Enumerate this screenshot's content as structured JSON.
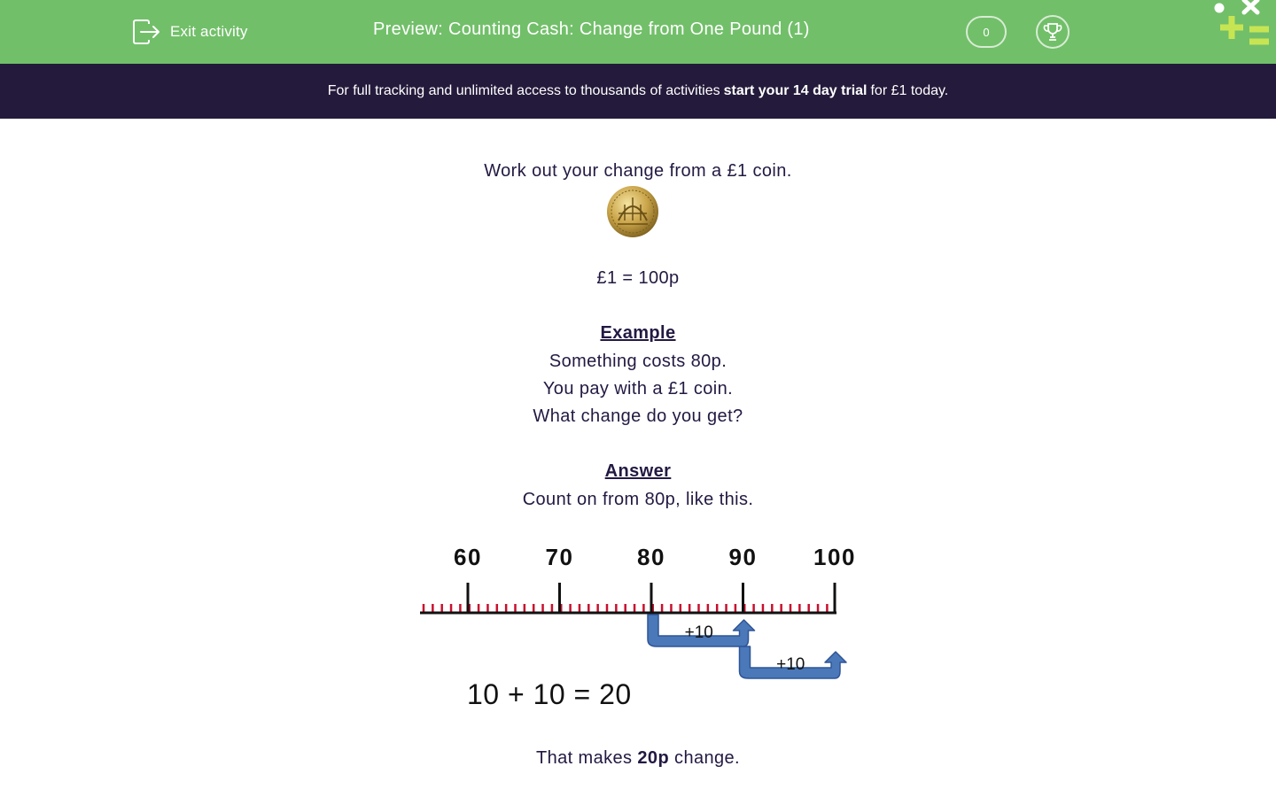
{
  "header": {
    "exit_label": "Exit activity",
    "title": "Preview: Counting Cash: Change from One Pound (1)",
    "score": "0",
    "background_color": "#72bf6a"
  },
  "banner": {
    "text_before": "For full tracking and unlimited access to thousands of activities",
    "text_strong": "start your 14 day trial",
    "text_after": "for £1 today.",
    "background_color": "#241a3b"
  },
  "question": {
    "prompt": "Work out your change from a £1 coin.",
    "coin_icon": "pound-coin-icon",
    "equivalence": "£1 = 100p",
    "example_heading": "Example",
    "example_lines": [
      "Something costs 80p.",
      "You pay with a £1 coin.",
      "What change do you get?"
    ],
    "answer_heading": "Answer",
    "answer_intro": "Count on from 80p, like this.",
    "number_line": {
      "tick_labels": [
        "60",
        "70",
        "80",
        "90",
        "100"
      ],
      "jumps": [
        {
          "from": "80",
          "to": "90",
          "label": "+10"
        },
        {
          "from": "90",
          "to": "100",
          "label": "+10"
        }
      ],
      "minor_tick_color": "#c8102e",
      "arrow_color": "#4a78b8"
    },
    "sum": "10 + 10 = 20",
    "conclusion_before": "That makes",
    "conclusion_strong": "20p",
    "conclusion_after": "change."
  }
}
